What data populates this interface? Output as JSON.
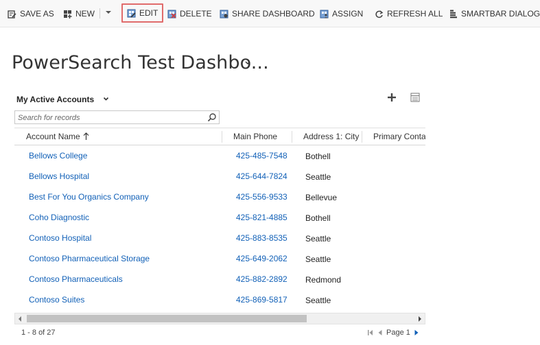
{
  "toolbar": {
    "save_as": "SAVE AS",
    "new": "NEW",
    "edit": "EDIT",
    "delete": "DELETE",
    "share_dashboard": "SHARE DASHBOARD",
    "assign": "ASSIGN",
    "refresh_all": "REFRESH ALL",
    "smartbar_dialog": "SMARTBAR DIALOG"
  },
  "page": {
    "title": "PowerSearch Test Dashbo..."
  },
  "view": {
    "name": "My Active Accounts",
    "search_placeholder": "Search for records"
  },
  "table": {
    "columns": [
      "Account Name",
      "Main Phone",
      "Address 1: City",
      "Primary Conta"
    ],
    "rows": [
      {
        "name": "Bellows College",
        "phone": "425-485-7548",
        "city": "Bothell"
      },
      {
        "name": "Bellows Hospital",
        "phone": "425-644-7824",
        "city": "Seattle"
      },
      {
        "name": "Best For You Organics Company",
        "phone": "425-556-9533",
        "city": "Bellevue"
      },
      {
        "name": "Coho Diagnostic",
        "phone": "425-821-4885",
        "city": "Bothell"
      },
      {
        "name": "Contoso Hospital",
        "phone": "425-883-8535",
        "city": "Seattle"
      },
      {
        "name": "Contoso Pharmaceutical Storage",
        "phone": "425-649-2062",
        "city": "Seattle"
      },
      {
        "name": "Contoso Pharmaceuticals",
        "phone": "425-882-2892",
        "city": "Redmond"
      },
      {
        "name": "Contoso Suites",
        "phone": "425-869-5817",
        "city": "Seattle"
      }
    ]
  },
  "footer": {
    "record_count": "1 - 8 of 27",
    "page_label": "Page 1"
  },
  "colors": {
    "link": "#1160b7",
    "highlight_border": "#e06b6b",
    "toolbar_bg": "#f8f8f8"
  }
}
